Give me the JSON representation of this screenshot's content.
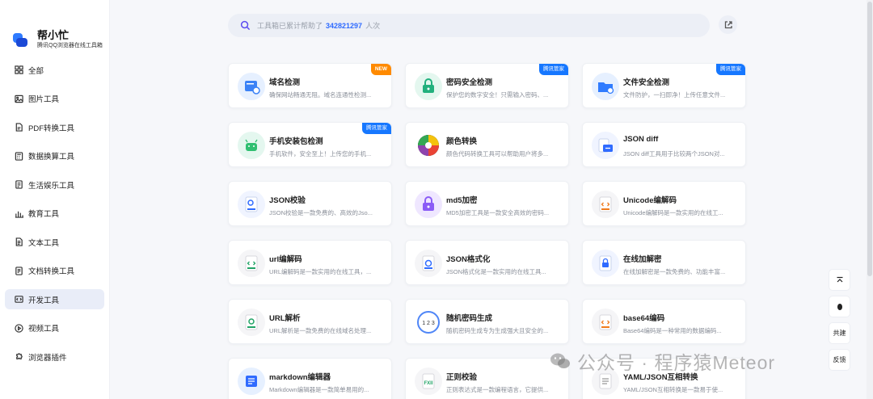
{
  "brand": {
    "title": "帮小忙",
    "subtitle": "腾讯QQ浏览器在线工具箱"
  },
  "sidebar": {
    "items": [
      {
        "label": "全部",
        "icon": "grid-icon"
      },
      {
        "label": "图片工具",
        "icon": "image-icon"
      },
      {
        "label": "PDF转换工具",
        "icon": "pdf-icon"
      },
      {
        "label": "数据换算工具",
        "icon": "calculator-icon"
      },
      {
        "label": "生活娱乐工具",
        "icon": "life-icon"
      },
      {
        "label": "教育工具",
        "icon": "bar-chart-icon"
      },
      {
        "label": "文本工具",
        "icon": "text-icon"
      },
      {
        "label": "文档转换工具",
        "icon": "document-icon"
      },
      {
        "label": "开发工具",
        "icon": "code-icon",
        "active": true
      },
      {
        "label": "视频工具",
        "icon": "video-icon"
      },
      {
        "label": "浏览器插件",
        "icon": "plugin-icon"
      }
    ]
  },
  "search": {
    "prefix": "工具箱已累计帮助了",
    "count": "342821297",
    "suffix": "人次"
  },
  "tools": [
    {
      "name": "域名检测",
      "desc": "确保网站畅通无阻。域名连通性检测...",
      "icon": "domain-icon",
      "badge": "NEW"
    },
    {
      "name": "密码安全检测",
      "desc": "保护您的数字安全！只需输入密码、...",
      "icon": "password-lock-icon",
      "badge": "腾讯管家"
    },
    {
      "name": "文件安全检测",
      "desc": "文件防护，一扫即净！上传任意文件...",
      "icon": "folder-shield-icon",
      "badge": "腾讯管家"
    },
    {
      "name": "手机安装包检测",
      "desc": "手机软件，安全至上！上传您的手机...",
      "icon": "android-icon",
      "badge": "腾讯管家"
    },
    {
      "name": "颜色转换",
      "desc": "颜色代码转换工具可以帮助用户将多...",
      "icon": "color-wheel-icon",
      "badge": ""
    },
    {
      "name": "JSON diff",
      "desc": "JSON diff工具用于比较两个JSON对...",
      "icon": "json-diff-icon",
      "badge": ""
    },
    {
      "name": "JSON校验",
      "desc": "JSON校验是一款免费的、高效的Jso...",
      "icon": "json-check-icon",
      "badge": ""
    },
    {
      "name": "md5加密",
      "desc": "MD5加密工具是一款安全高效的密码...",
      "icon": "md5-lock-icon",
      "badge": ""
    },
    {
      "name": "Unicode编解码",
      "desc": "Unicode编解码是一款实用的在线工...",
      "icon": "unicode-file-icon",
      "badge": ""
    },
    {
      "name": "url编解码",
      "desc": "URL编解码是一款实用的在线工具，...",
      "icon": "url-code-icon",
      "badge": ""
    },
    {
      "name": "JSON格式化",
      "desc": "JSON格式化是一款实用的在线工具...",
      "icon": "json-format-icon",
      "badge": ""
    },
    {
      "name": "在线加解密",
      "desc": "在线加解密是一款免费的、功能丰富...",
      "icon": "file-lock-icon",
      "badge": ""
    },
    {
      "name": "URL解析",
      "desc": "URL解析是一款免费的在线域名处理...",
      "icon": "url-parse-icon",
      "badge": ""
    },
    {
      "name": "随机密码生成",
      "desc": "随机密码生成专为生成强大且安全的...",
      "icon": "random-123-icon",
      "badge": ""
    },
    {
      "name": "base64编码",
      "desc": "Base64编码是一种常用的数据编码...",
      "icon": "base64-file-icon",
      "badge": ""
    },
    {
      "name": "markdown编辑器",
      "desc": "Markdown编辑器是一款简单易用的...",
      "icon": "markdown-icon",
      "badge": ""
    },
    {
      "name": "正则校验",
      "desc": "正则表达式是一款编程语言，它提供...",
      "icon": "regex-icon",
      "badge": ""
    },
    {
      "name": "YAML/JSON互相转换",
      "desc": "YAML/JSON互相转换是一款易于使...",
      "icon": "yaml-icon",
      "badge": ""
    }
  ],
  "floating": {
    "top_icon": "back-to-top-icon",
    "qq_icon": "qq-penguin-icon",
    "cobuild_label": "共建",
    "feedback_label": "反馈"
  },
  "watermark": {
    "text": "公众号 · 程序猿Meteor",
    "icon": "wechat-icon"
  },
  "colors": {
    "accent": "#2f6bff",
    "badge_new": "#ff8a00",
    "badge_tencent": "#1677ff",
    "active_bg": "#e9edf8"
  }
}
